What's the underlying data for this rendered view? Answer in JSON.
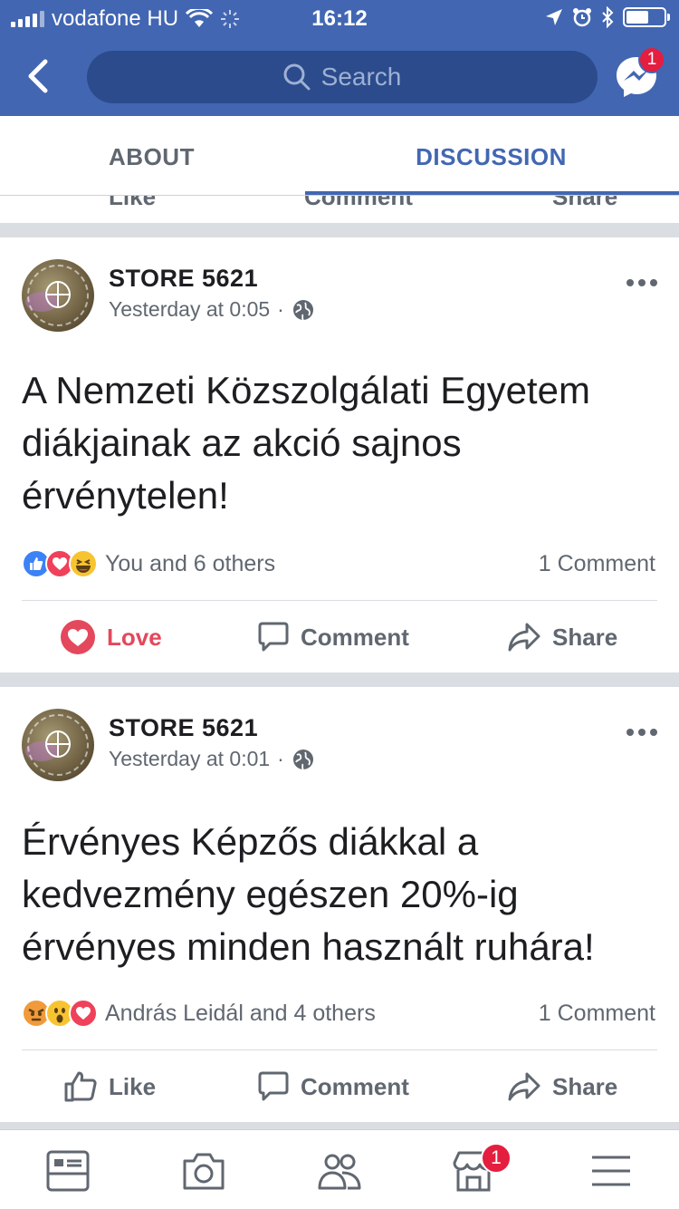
{
  "status_bar": {
    "carrier": "vodafone HU",
    "time": "16:12"
  },
  "header": {
    "search_placeholder": "Search",
    "messenger_badge": "1"
  },
  "tabs": [
    {
      "label": "ABOUT",
      "active": false
    },
    {
      "label": "DISCUSSION",
      "active": true
    }
  ],
  "previous_post_actions": [
    "Like",
    "Comment",
    "Share"
  ],
  "posts": [
    {
      "author": "STORE 5621",
      "time": "Yesterday at 0:05",
      "separator": "·",
      "text": "A Nemzeti Közszolgálati Egyetem diákjainak az akció sajnos érvénytelen!",
      "reactions": [
        "like",
        "love",
        "haha"
      ],
      "reaction_text": "You and 6 others",
      "comments": "1 Comment",
      "actions": {
        "reaction": "Love",
        "comment": "Comment",
        "share": "Share"
      }
    },
    {
      "author": "STORE 5621",
      "time": "Yesterday at 0:01",
      "separator": "·",
      "text": "Érvényes Képzős diákkal a kedvezmény egészen 20%-ig érvényes minden használt ruhára!",
      "reactions": [
        "angry",
        "wow",
        "love"
      ],
      "reaction_text": "András Leidál and 4 others",
      "comments": "1 Comment",
      "actions": {
        "reaction": "Like",
        "comment": "Comment",
        "share": "Share"
      }
    }
  ],
  "bottom_nav": {
    "items": [
      "news-feed-icon",
      "camera-icon",
      "friends-icon",
      "marketplace-icon",
      "menu-icon"
    ],
    "marketplace_badge": "1"
  },
  "colors": {
    "brand_blue": "#4266b2",
    "active_tab": "#4267b2",
    "love_red": "#e4485c",
    "badge_red": "#e41e3f"
  }
}
